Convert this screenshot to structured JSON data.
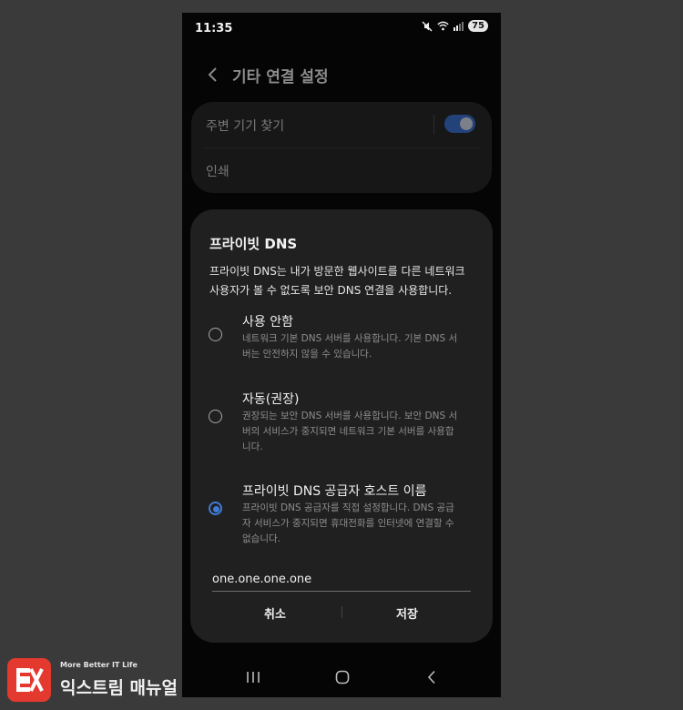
{
  "status_bar": {
    "time": "11:35",
    "battery": "75",
    "icons": [
      "mute-icon",
      "wifi-icon",
      "signal-icon"
    ]
  },
  "app_bar": {
    "title": "기타 연결 설정"
  },
  "settings": {
    "items": [
      {
        "label": "주변 기기 찾기",
        "toggle": "on"
      },
      {
        "label": "인쇄"
      }
    ]
  },
  "dialog": {
    "title": "프라이빗 DNS",
    "description": "프라이빗 DNS는 내가 방문한 웹사이트를 다른 네트워크 사용자가 볼 수 없도록 보안 DNS 연결을 사용합니다.",
    "options": [
      {
        "title": "사용 안함",
        "desc": "네트워크 기본 DNS 서버를 사용합니다. 기본 DNS 서버는 안전하지 않을 수 있습니다.",
        "selected": false
      },
      {
        "title": "자동(권장)",
        "desc": "권장되는 보안 DNS 서버를 사용합니다. 보안 DNS 서버의 서비스가 중지되면 네트워크 기본 서버를 사용합니다.",
        "selected": false
      },
      {
        "title": "프라이빗 DNS 공급자 호스트 이름",
        "desc": "프라이빗 DNS 공급자를 직접 설정합니다. DNS 공급자 서비스가 중지되면 휴대전화를 인터넷에 연결할 수 없습니다.",
        "selected": true
      }
    ],
    "hostname_value": "one.one.one.one",
    "cancel_label": "취소",
    "save_label": "저장"
  },
  "nav_bar": {
    "icons": [
      "recent-apps-icon",
      "home-icon",
      "back-icon"
    ]
  },
  "watermark": {
    "tagline": "More Better IT Life",
    "name": "익스트림 매뉴얼"
  },
  "colors": {
    "accent": "#3f7bd6",
    "dialog_bg": "#202020",
    "logo_red": "#e3392f"
  }
}
